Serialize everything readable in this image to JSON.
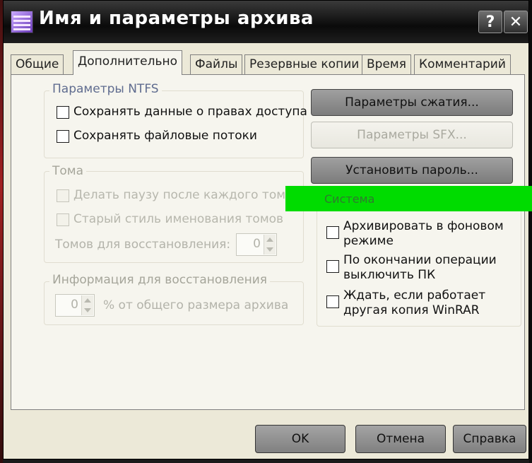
{
  "window": {
    "title": "Имя и параметры архива",
    "help": "?",
    "close": "✕"
  },
  "tabs": [
    {
      "label": "Общие"
    },
    {
      "label": "Дополнительно",
      "active": true
    },
    {
      "label": "Файлы"
    },
    {
      "label": "Резервные копии"
    },
    {
      "label": "Время"
    },
    {
      "label": "Комментарий"
    }
  ],
  "ntfs": {
    "title": "Параметры NTFS",
    "save_access": "Сохранять данные о правах доступа",
    "save_streams": "Сохранять файловые потоки"
  },
  "volumes": {
    "title": "Тома",
    "pause": "Делать паузу после каждого тома",
    "old_style": "Старый стиль именования томов",
    "recovery_label": "Томов для восстановления:",
    "recovery_value": "0"
  },
  "recovery_info": {
    "title": "Информация для восстановления",
    "value": "0",
    "suffix": "% от общего размера архива"
  },
  "buttons": {
    "compression": "Параметры сжатия...",
    "sfx": "Параметры SFX...",
    "password": "Установить пароль..."
  },
  "system": {
    "title": "Система",
    "background_l1": "Архивировать в фоновом",
    "background_l2": "режиме",
    "shutdown_l1": "По окончании операции",
    "shutdown_l2": "выключить ПК",
    "wait_l1": "Ждать, если работает",
    "wait_l2": "другая копия WinRAR"
  },
  "footer": {
    "ok": "OK",
    "cancel": "Отмена",
    "help": "Справка"
  },
  "colors": {
    "highlight": "#00dc00",
    "group_title": "#5f6c8f"
  }
}
